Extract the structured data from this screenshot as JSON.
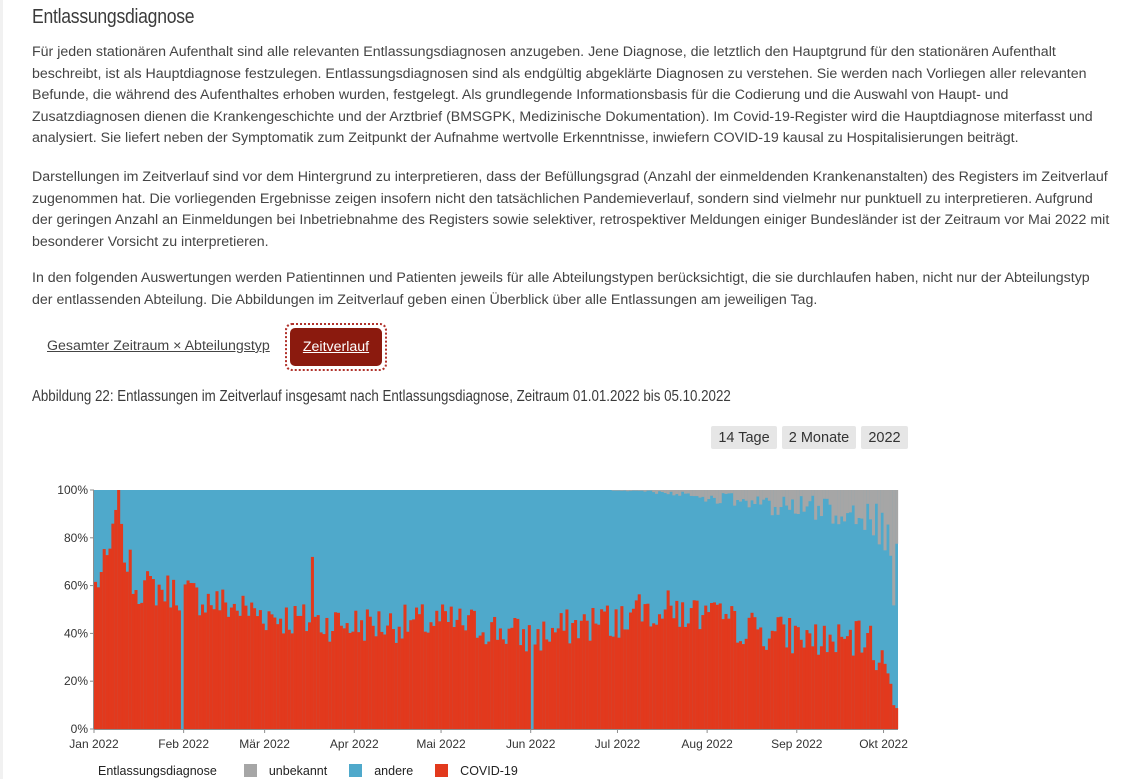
{
  "section": {
    "title": "Entlassungsdiagnose"
  },
  "paragraphs": [
    "Für jeden stationären Aufenthalt sind alle relevanten Entlassungsdiagnosen anzugeben. Jene Diagnose, die letztlich den Hauptgrund für den stationären Aufenthalt beschreibt, ist als Hauptdiagnose festzulegen. Entlassungsdiagnosen sind als endgültig abgeklärte Diagnosen zu verstehen. Sie werden nach Vorliegen aller relevanten Befunde, die während des Aufenthaltes erhoben wurden, festgelegt. Als grundlegende Informationsbasis für die Codierung und die Auswahl von Haupt- und Zusatzdiagnosen dienen die Krankengeschichte und der Arztbrief (BMSGPK, Medizinische Dokumentation). Im Covid-19-Register wird die Hauptdiagnose miterfasst und analysiert. Sie liefert neben der Symptomatik zum Zeitpunkt der Aufnahme wertvolle Erkenntnisse, inwiefern COVID-19 kausal zu Hospitalisierungen beiträgt.",
    "Darstellungen im Zeitverlauf sind vor dem Hintergrund zu interpretieren, dass der Befüllungsgrad (Anzahl der einmeldenden Krankenanstalten) des Registers im Zeitverlauf zugenommen hat. Die vorliegenden Ergebnisse zeigen insofern nicht den tatsächlichen Pandemieverlauf, sondern sind vielmehr nur punktuell zu interpretieren. Aufgrund der geringen Anzahl an Einmeldungen bei Inbetriebnahme des Registers sowie selektiver, retrospektiver Meldungen einiger Bundesländer ist der Zeitraum vor Mai 2022 mit besonderer Vorsicht zu interpretieren.",
    "In den folgenden Auswertungen werden Patientinnen und Patienten jeweils für alle Abteilungstypen berücksichtigt, die sie durchlaufen haben, nicht nur der Abteilungstyp der entlassenden Abteilung. Die Abbildungen im Zeitverlauf geben einen Überblick über alle Entlassungen am jeweiligen Tag."
  ],
  "tabs": {
    "overall_label": "Gesamter Zeitraum × Abteilungstyp",
    "timeline_label": "Zeitverlauf"
  },
  "figure": {
    "caption": "Abbildung 22: Entlassungen im Zeitverlauf insgesamt nach Entlassungsdiagnose, Zeitraum 01.01.2022 bis 05.10.2022"
  },
  "range_buttons": [
    "14 Tage",
    "2 Monate",
    "2022"
  ],
  "legend": {
    "title": "Entlassungsdiagnose",
    "items": [
      "unbekannt",
      "andere",
      "COVID-19"
    ]
  },
  "chart_data": {
    "type": "bar",
    "stacked": true,
    "normalized_percent": true,
    "x_range": [
      "2022-01-01",
      "2022-10-05"
    ],
    "x_ticks": [
      "Jan 2022",
      "Feb 2022",
      "Mär 2022",
      "Apr 2022",
      "Mai 2022",
      "Jun 2022",
      "Jul 2022",
      "Aug 2022",
      "Sep 2022",
      "Okt 2022"
    ],
    "y_ticks": [
      "0%",
      "20%",
      "40%",
      "60%",
      "80%",
      "100%"
    ],
    "ylim": [
      0,
      100
    ],
    "grid": false,
    "legend_position": "bottom",
    "colors": {
      "unbekannt": "#a6a6a6",
      "andere": "#4fa9cb",
      "COVID-19": "#e2391d"
    },
    "series_anchors": {
      "COVID-19": [
        {
          "date": "2022-01-01",
          "pct": 60
        },
        {
          "date": "2022-01-05",
          "pct": 70
        },
        {
          "date": "2022-01-08",
          "pct": 85
        },
        {
          "date": "2022-01-15",
          "pct": 60
        },
        {
          "date": "2022-01-31",
          "pct": 57
        },
        {
          "date": "2022-02-15",
          "pct": 52
        },
        {
          "date": "2022-03-01",
          "pct": 48
        },
        {
          "date": "2022-03-15",
          "pct": 45
        },
        {
          "date": "2022-04-01",
          "pct": 44
        },
        {
          "date": "2022-04-15",
          "pct": 44
        },
        {
          "date": "2022-05-01",
          "pct": 45
        },
        {
          "date": "2022-05-15",
          "pct": 43
        },
        {
          "date": "2022-06-01",
          "pct": 38
        },
        {
          "date": "2022-06-15",
          "pct": 43
        },
        {
          "date": "2022-07-01",
          "pct": 46
        },
        {
          "date": "2022-07-15",
          "pct": 51
        },
        {
          "date": "2022-08-01",
          "pct": 47
        },
        {
          "date": "2022-08-15",
          "pct": 42
        },
        {
          "date": "2022-09-01",
          "pct": 39
        },
        {
          "date": "2022-09-15",
          "pct": 36
        },
        {
          "date": "2022-09-25",
          "pct": 38
        },
        {
          "date": "2022-10-01",
          "pct": 26
        },
        {
          "date": "2022-10-05",
          "pct": 12
        }
      ],
      "unbekannt": [
        {
          "date": "2022-01-01",
          "pct": 0
        },
        {
          "date": "2022-06-25",
          "pct": 0
        },
        {
          "date": "2022-07-15",
          "pct": 1
        },
        {
          "date": "2022-08-01",
          "pct": 3
        },
        {
          "date": "2022-08-20",
          "pct": 6
        },
        {
          "date": "2022-09-10",
          "pct": 8
        },
        {
          "date": "2022-09-25",
          "pct": 10
        },
        {
          "date": "2022-10-01",
          "pct": 22
        },
        {
          "date": "2022-10-05",
          "pct": 45
        }
      ]
    },
    "notable_days": [
      {
        "date": "2022-01-31",
        "COVID-19": 0,
        "unbekannt": 0
      },
      {
        "date": "2022-06-01",
        "COVID-19": 0,
        "unbekannt": 0
      },
      {
        "date": "2022-01-09",
        "COVID-19": 100,
        "unbekannt": 0
      },
      {
        "date": "2022-03-17",
        "COVID-19": 72,
        "unbekannt": 0
      }
    ]
  }
}
